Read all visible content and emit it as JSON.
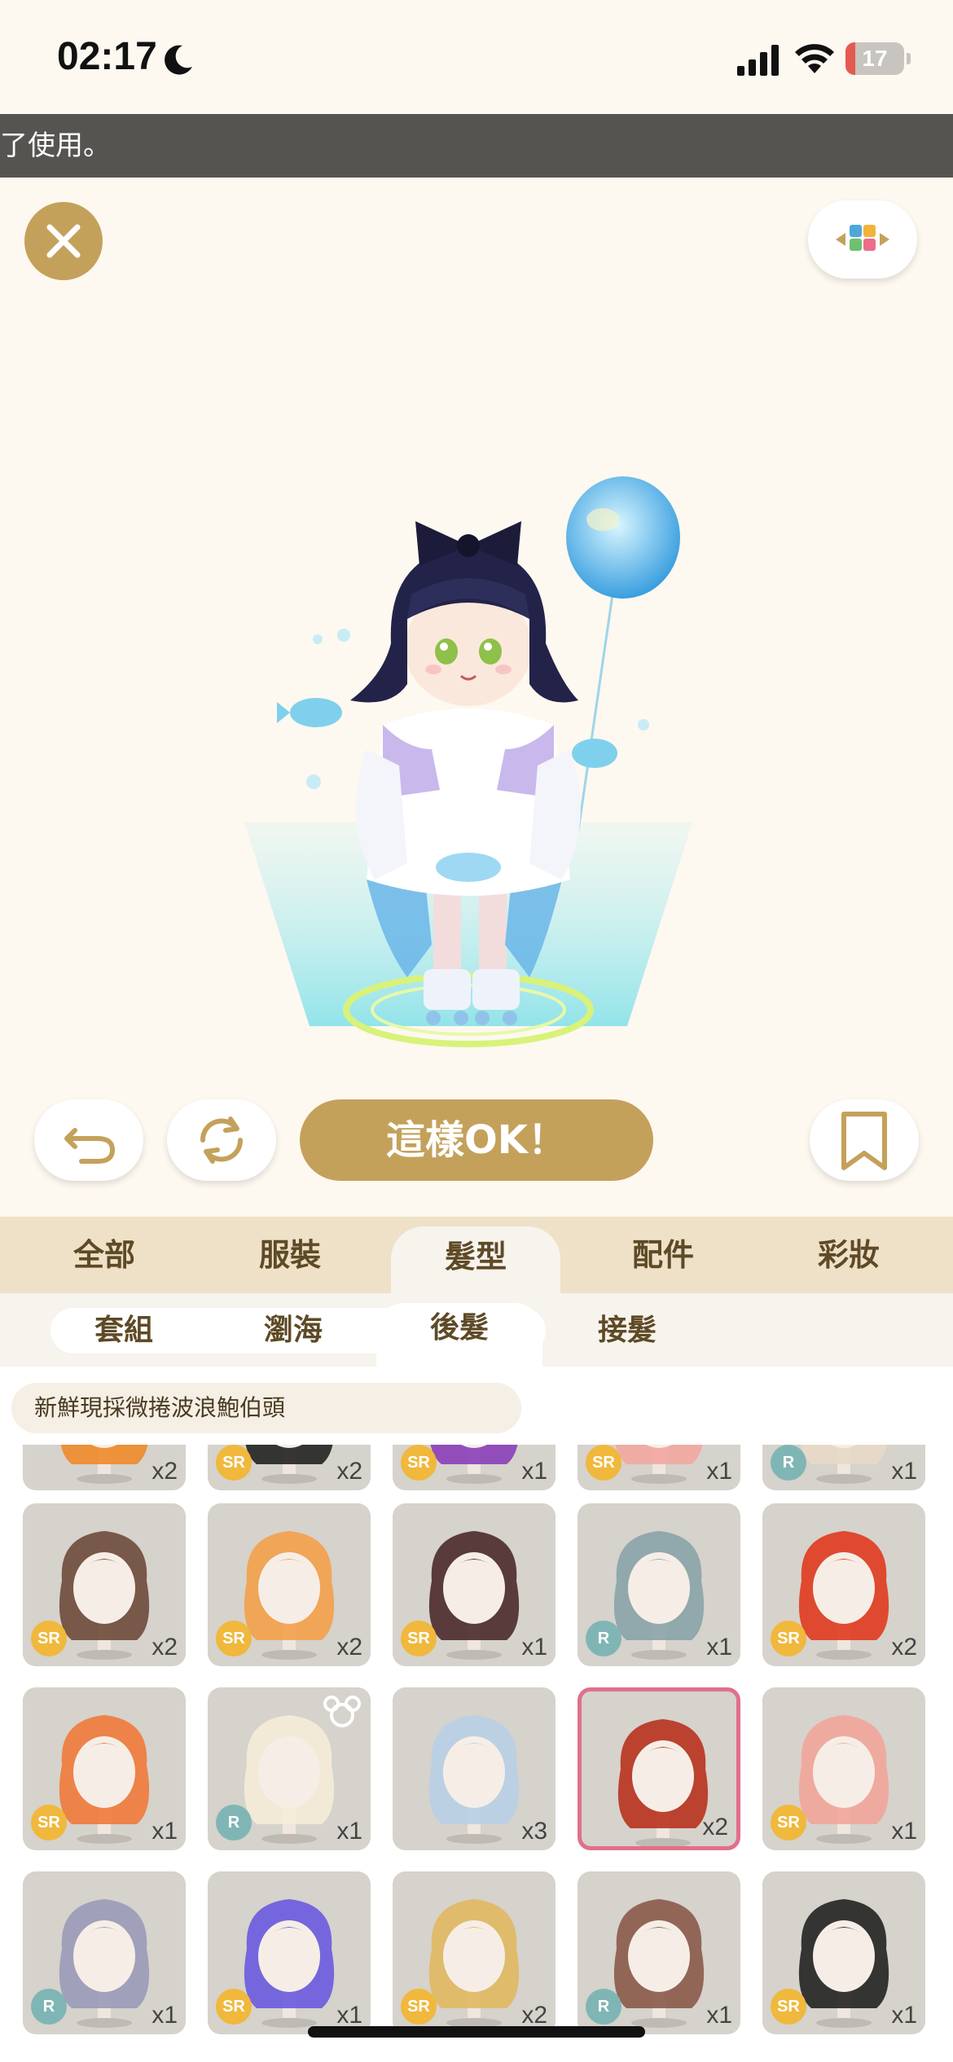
{
  "status_bar": {
    "time": "02:17",
    "battery_level": 17,
    "battery_label": "17"
  },
  "banner": {
    "text": "了使用。"
  },
  "buttons": {
    "confirm_label": "這樣OK！"
  },
  "main_tabs": [
    {
      "label": "全部",
      "active": false
    },
    {
      "label": "服裝",
      "active": false
    },
    {
      "label": "髮型",
      "active": true
    },
    {
      "label": "配件",
      "active": false
    },
    {
      "label": "彩妝",
      "active": false
    }
  ],
  "sub_tabs": [
    {
      "label": "套組",
      "active": false
    },
    {
      "label": "瀏海",
      "active": false
    },
    {
      "label": "後髮",
      "active": true
    },
    {
      "label": "接髮",
      "active": false
    }
  ],
  "selected_item_name": "新鮮現採微捲波浪鮑伯頭",
  "items": [
    {
      "rarity": "",
      "count": "x2",
      "color": "#f08a2a"
    },
    {
      "rarity": "SR",
      "count": "x2",
      "color": "#222222"
    },
    {
      "rarity": "SR",
      "count": "x1",
      "color": "#8a3fb8"
    },
    {
      "rarity": "SR",
      "count": "x1",
      "color": "#f2a7a0"
    },
    {
      "rarity": "R",
      "count": "x1",
      "color": "#e8d9c8"
    },
    {
      "rarity": "SR",
      "count": "x2",
      "color": "#6e4a3a"
    },
    {
      "rarity": "SR",
      "count": "x2",
      "color": "#f3a04a"
    },
    {
      "rarity": "SR",
      "count": "x1",
      "color": "#4a2a2a"
    },
    {
      "rarity": "R",
      "count": "x1",
      "color": "#8aa3a8"
    },
    {
      "rarity": "SR",
      "count": "x2",
      "color": "#e03a1e"
    },
    {
      "rarity": "SR",
      "count": "x1",
      "color": "#f07a3a"
    },
    {
      "rarity": "R",
      "count": "x1",
      "color": "#f5ecd8"
    },
    {
      "rarity": "",
      "count": "x3",
      "color": "#b8cfe6"
    },
    {
      "rarity": "",
      "count": "x2",
      "color": "#b8321e"
    },
    {
      "rarity": "SR",
      "count": "x1",
      "color": "#f2a59a"
    },
    {
      "rarity": "R",
      "count": "x1",
      "color": "#9a9ab8"
    },
    {
      "rarity": "SR",
      "count": "x1",
      "color": "#6a5ae0"
    },
    {
      "rarity": "SR",
      "count": "x2",
      "color": "#e0b860"
    },
    {
      "rarity": "R",
      "count": "x1",
      "color": "#8a5a4a"
    },
    {
      "rarity": "SR",
      "count": "x1",
      "color": "#222222"
    }
  ],
  "icons": {
    "close": "close-icon",
    "layer_toggle": "layer-toggle-icon",
    "undo": "undo-icon",
    "refresh": "refresh-icon",
    "bookmark": "bookmark-icon",
    "bear": "bear-icon"
  },
  "colors": {
    "accent_gold": "#c4a15b",
    "tab_bg": "#eee1c8",
    "selected_border": "#e0708a",
    "badge_sr": "#f0b83c",
    "badge_r": "#7fb6b5"
  }
}
